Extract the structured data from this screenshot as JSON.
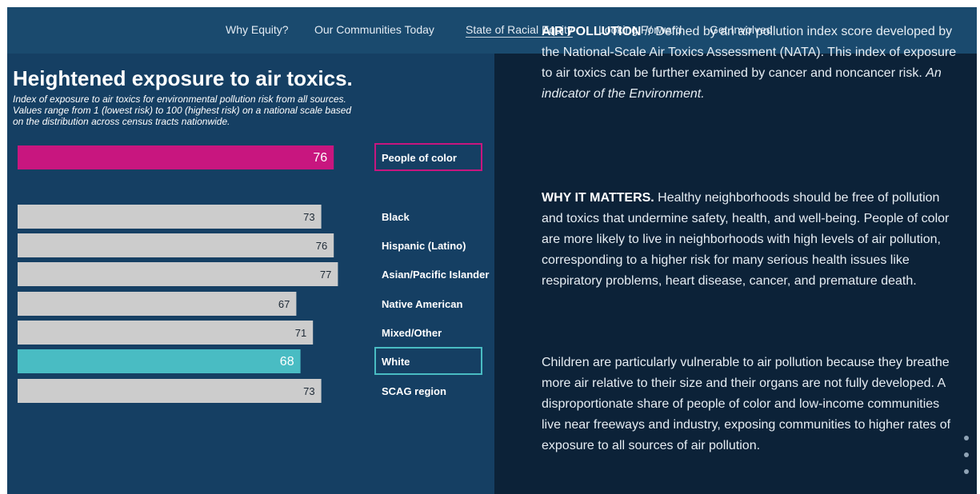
{
  "nav": {
    "items": [
      {
        "label": "Why Equity?"
      },
      {
        "label": "Our Communities Today"
      },
      {
        "label": "State of Racial Equity"
      },
      {
        "label": "Looking Forward"
      },
      {
        "label": "Get Involved"
      }
    ],
    "active_index": 2
  },
  "chart_data": {
    "type": "bar",
    "orientation": "horizontal",
    "title": "Heightened exposure to air toxics.",
    "subtitle_lines": [
      "Index of exposure to air toxics for environmental pollution risk from all sources.",
      "Values range from 1 (lowest risk) to 100 (highest risk) on a national scale based",
      "on the distribution across census tracts nationwide."
    ],
    "categories": [
      "People of color",
      "Black",
      "Hispanic (Latino)",
      "Asian/Pacific Islander",
      "Native American",
      "Mixed/Other",
      "White",
      "SCAG region"
    ],
    "values": [
      76,
      73,
      76,
      77,
      67,
      71,
      68,
      73
    ],
    "bar_colors": [
      "#c8167f",
      "#cccccc",
      "#cccccc",
      "#cccccc",
      "#cccccc",
      "#cccccc",
      "#49bcc3",
      "#cccccc"
    ],
    "highlighted": [
      "People of color",
      "White"
    ],
    "xlim": [
      0,
      100
    ],
    "grid": false,
    "legend": "none"
  },
  "colors": {
    "accent_magenta": "#c8167f",
    "accent_teal": "#49bcc3",
    "bar_gray": "#cccccc"
  },
  "text": {
    "p1_lead": "AIR POLLUTION",
    "p1_body": " // Defined by an air pollution index score developed by the National-Scale Air Toxics Assessment (NATA). This index of exposure to air toxics can be further examined by cancer and noncancer risk. ",
    "p1_italic": "An indicator of the Environment.",
    "p2_lead": "WHY IT MATTERS.",
    "p2_body": " Healthy neighborhoods should be free of pollution and toxics that undermine safety, health, and well-being. People of color are more likely to live in neighborhoods with high levels of air pollution, corresponding to a higher risk for many serious health issues like respiratory problems, heart disease, cancer, and premature death.",
    "p3": "Children are particularly vulnerable to air pollution because they breathe more air relative to their size and their organs are not fully developed. A disproportionate share of people of color and low-income communities live near freeways and industry, exposing communities to higher rates of exposure to all sources of air pollution."
  }
}
